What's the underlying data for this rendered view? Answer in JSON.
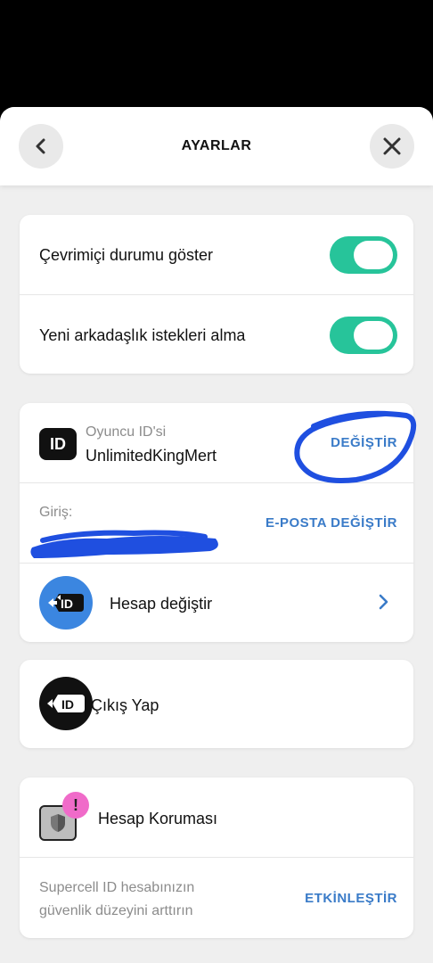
{
  "header": {
    "title": "AYARLAR",
    "back_icon": "chevron-left-icon",
    "close_icon": "close-icon"
  },
  "privacy": {
    "online_status_label": "Çevrimiçi durumu göster",
    "online_status_on": true,
    "friend_requests_label": "Yeni arkadaşlık istekleri alma",
    "friend_requests_on": true
  },
  "account": {
    "player_id_label": "Oyuncu ID'si",
    "player_id_value": "UnlimitedKingMert",
    "player_id_action": "DEĞİŞTİR",
    "login_label": "Giriş:",
    "login_action": "E-POSTA DEĞİŞTİR",
    "switch_label": "Hesap değiştir"
  },
  "logout": {
    "label": "Çıkış Yap"
  },
  "protection": {
    "title": "Hesap Koruması",
    "description_line1": "Supercell ID hesabınızın",
    "description_line2": "güvenlik düzeyini arttırın",
    "action": "ETKİNLEŞTİR",
    "badge": "!"
  },
  "colors": {
    "toggle": "#27c49a",
    "link": "#3a7bc8",
    "switch_icon_bg": "#3b86e0",
    "annotation": "#1f4fe0",
    "alert_badge": "#f06bc9"
  }
}
